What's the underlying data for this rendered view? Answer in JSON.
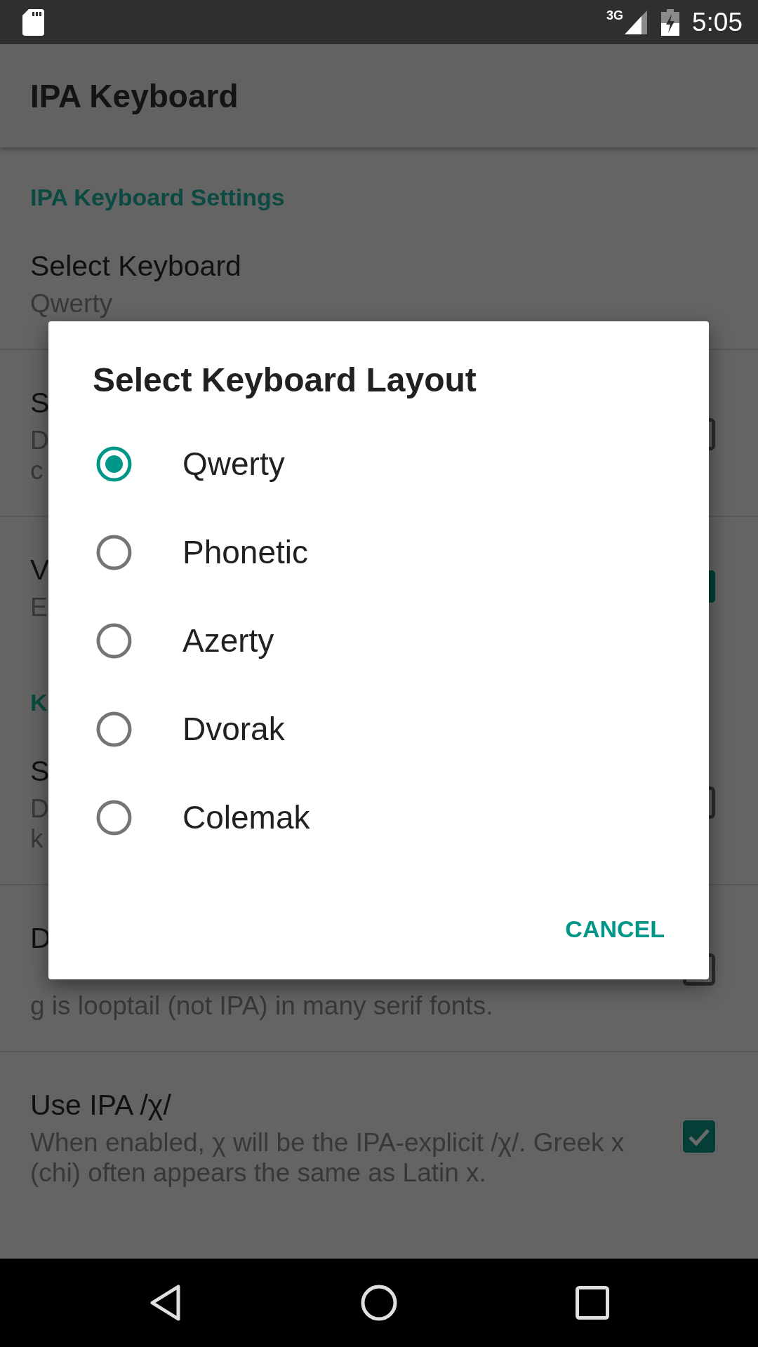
{
  "status_bar": {
    "network": "3G",
    "time": "5:05"
  },
  "app_bar": {
    "title": "IPA Keyboard"
  },
  "settings": {
    "sections": [
      {
        "header": "IPA Keyboard Settings",
        "items": [
          {
            "kind": "select",
            "title": "Select Keyboard",
            "summary": "Qwerty"
          },
          {
            "kind": "checkbox",
            "title": "S",
            "summary": "D\nc",
            "checked": false
          },
          {
            "kind": "checkbox",
            "title": "V",
            "summary": "E",
            "checked": true
          }
        ]
      },
      {
        "header": "K",
        "items": [
          {
            "kind": "checkbox",
            "title": "S",
            "summary": "D\nk",
            "checked": false
          },
          {
            "kind": "checkbox",
            "title": "D",
            "summary": "g is looptail (not IPA) in many serif fonts.",
            "checked": false
          },
          {
            "kind": "checkbox",
            "title": "Use IPA /χ/",
            "summary": "When enabled, χ will be the IPA-explicit /χ/. Greek x\n(chi) often appears the same as Latin x.",
            "checked": true
          }
        ]
      }
    ]
  },
  "dialog": {
    "title": "Select Keyboard Layout",
    "options": [
      {
        "label": "Qwerty",
        "selected": true
      },
      {
        "label": "Phonetic",
        "selected": false
      },
      {
        "label": "Azerty",
        "selected": false
      },
      {
        "label": "Dvorak",
        "selected": false
      },
      {
        "label": "Colemak",
        "selected": false
      }
    ],
    "buttons": [
      {
        "label": "CANCEL"
      }
    ]
  }
}
